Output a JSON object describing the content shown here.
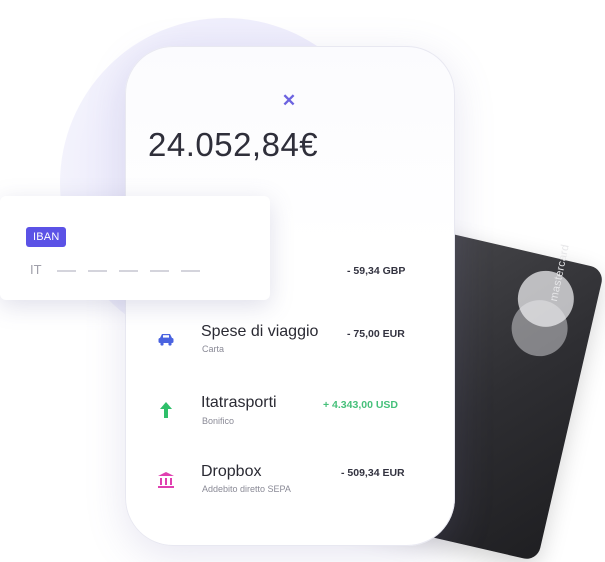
{
  "colors": {
    "accent": "#5b52e6",
    "positive": "#46c07a",
    "car_icon": "#4a63e0",
    "arrow_icon": "#2fbf6a",
    "bank_icon": "#e040b0"
  },
  "app": {
    "balance": "24.052,84€"
  },
  "iban_card": {
    "badge": "IBAN",
    "prefix": "IT"
  },
  "transactions": [
    {
      "amount": "- 59,34 GBP"
    },
    {
      "icon": "car-icon",
      "title": "Spese di viaggio",
      "subtitle": "Carta",
      "amount": "- 75,00 EUR"
    },
    {
      "icon": "arrow-up-icon",
      "title": "Itatrasporti",
      "subtitle": "Bonifico",
      "amount": "+ 4.343,00 USD"
    },
    {
      "icon": "bank-icon",
      "title": "Dropbox",
      "subtitle": "Addebito diretto SEPA",
      "amount": "- 509,34 EUR"
    }
  ],
  "card": {
    "brand": "mastercard"
  }
}
